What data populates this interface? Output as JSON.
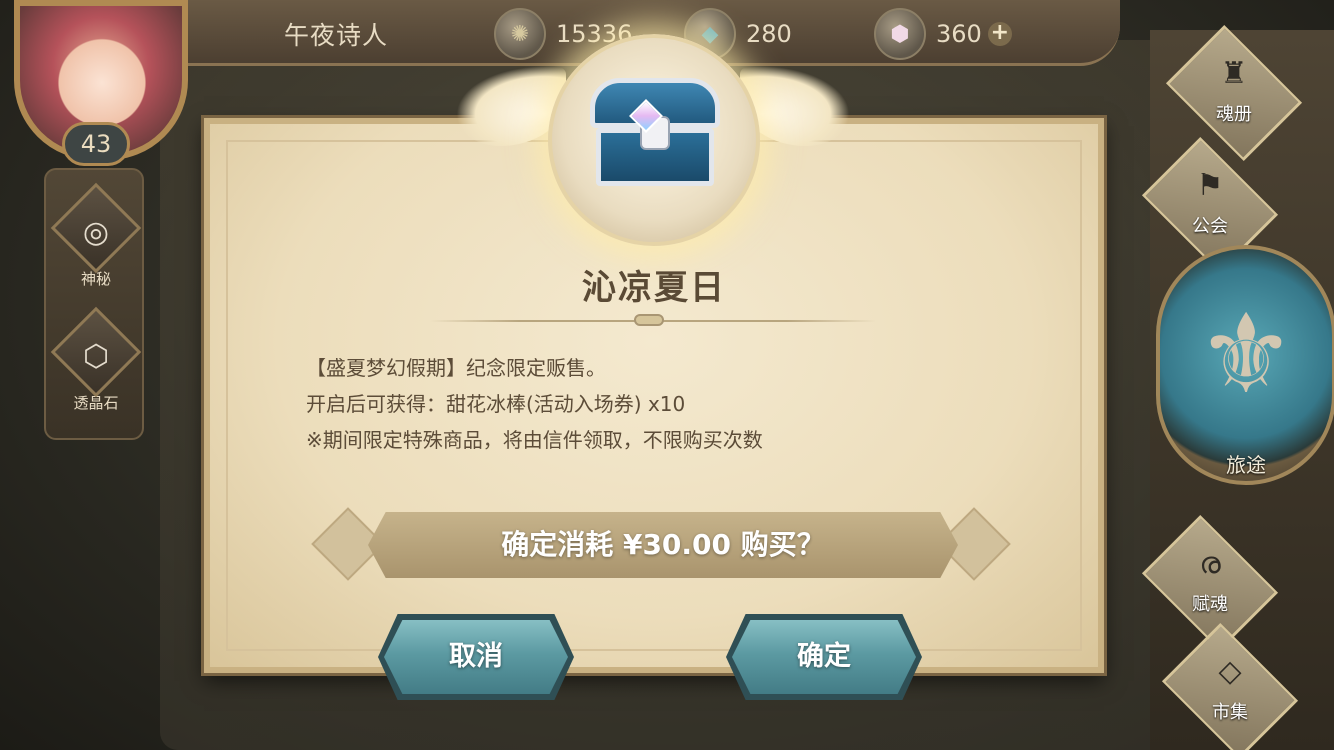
{
  "player": {
    "name": "午夜诗人",
    "level": "43"
  },
  "currencies": [
    {
      "name": "gold-coin-icon",
      "value": "15336"
    },
    {
      "name": "crystal-icon",
      "value": "280"
    },
    {
      "name": "gem-icon",
      "value": "360"
    }
  ],
  "left_menu": [
    {
      "label": "神秘"
    },
    {
      "label": "透晶石"
    }
  ],
  "right_menu": [
    {
      "label": "魂册"
    },
    {
      "label": "公会"
    },
    {
      "label": "旅途"
    },
    {
      "label": "赋魂"
    },
    {
      "label": "市集"
    }
  ],
  "dialog": {
    "title": "沁凉夏日",
    "lines": [
      "【盛夏梦幻假期】纪念限定贩售。",
      "开启后可获得：甜花冰棒(活动入场券) x10",
      "※期间限定特殊商品，将由信件领取，不限购买次数"
    ],
    "confirm_text": "确定消耗 ¥30.00 购买？",
    "cancel_label": "取消",
    "ok_label": "确定"
  },
  "plus_symbol": "+"
}
